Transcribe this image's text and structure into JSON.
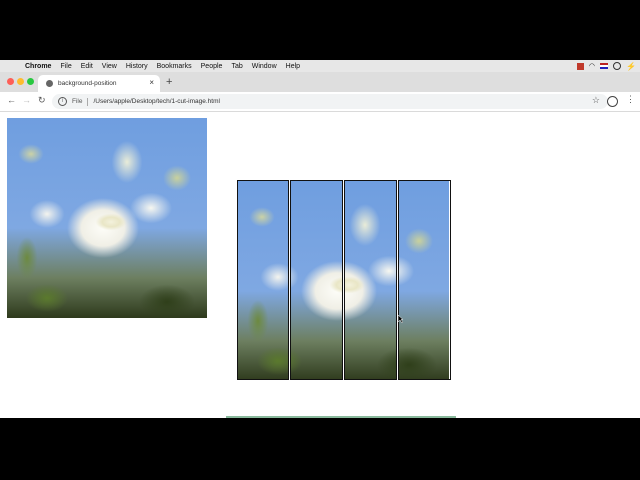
{
  "menubar": {
    "app_name": "Chrome",
    "items": [
      "File",
      "Edit",
      "View",
      "History",
      "Bookmarks",
      "People",
      "Tab",
      "Window",
      "Help"
    ]
  },
  "tab": {
    "title": "background-position",
    "close_glyph": "×"
  },
  "toolbar": {
    "scheme_label": "File",
    "url": "/Users/apple/Desktop/tech/1-cut-image.html"
  },
  "colors": {
    "traffic_red": "#fe5f57",
    "traffic_yellow": "#febc2e",
    "traffic_green": "#28c840",
    "menubar_bg": "#e7e7e7",
    "tabstrip_bg": "#dedede"
  },
  "icons": {
    "apple": "apple-icon",
    "back": "arrow-left-icon",
    "forward": "arrow-right-icon",
    "reload": "reload-icon",
    "info": "info-icon",
    "star": "star-icon",
    "profile": "profile-icon",
    "menu": "kebab-menu-icon",
    "new_tab": "plus-icon"
  }
}
